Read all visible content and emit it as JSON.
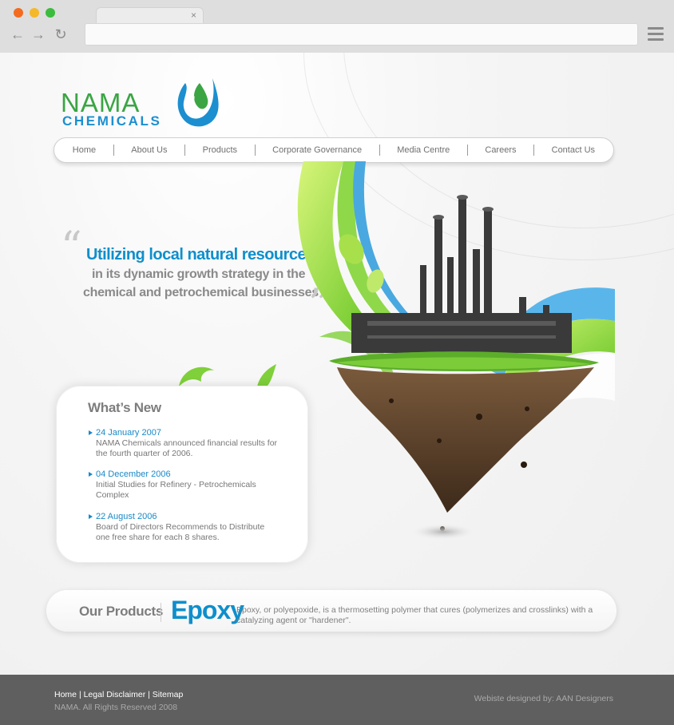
{
  "browser": {
    "tab_close": "×"
  },
  "logo": {
    "name": "NAMA",
    "subname": "CHEMICALS"
  },
  "nav": {
    "items": [
      {
        "label": "Home"
      },
      {
        "label": "About Us"
      },
      {
        "label": "Products"
      },
      {
        "label": "Corporate Governance"
      },
      {
        "label": "Media Centre"
      },
      {
        "label": "Careers"
      },
      {
        "label": "Contact Us"
      }
    ]
  },
  "hero": {
    "quote_open": "“",
    "quote_close": "”",
    "line1": "Utilizing local natural resources",
    "line2": "in its dynamic growth strategy in the",
    "line3": "chemical and petrochemical businesses"
  },
  "whats_new": {
    "title": "What’s New",
    "items": [
      {
        "date": "24 January 2007",
        "text": "NAMA Chemicals announced financial results for the fourth quarter of 2006."
      },
      {
        "date": "04 December 2006",
        "text": "Initial Studies for Refinery - Petrochemicals Complex"
      },
      {
        "date": "22 August 2006",
        "text": "Board of Directors Recommends to Distribute one free share for each 8 shares."
      }
    ]
  },
  "products": {
    "label": "Our Products",
    "featured_name": "Epoxy",
    "featured_desc": "Epoxy, or polyepoxide, is a thermosetting polymer that cures (polymerizes and crosslinks) with a catalyzing agent or \"hardener\"."
  },
  "footer": {
    "links": [
      "Home",
      "Legal Disclaimer",
      "Sitemap"
    ],
    "link_separator": "|",
    "copyright": "NAMA. All Rights Reserved 2008",
    "credit": "Webiste designed by: AAN Designers"
  },
  "colors": {
    "brand_blue": "#0e8fcc",
    "brand_green": "#3ba544",
    "footer_bg": "#5f5f5f"
  }
}
